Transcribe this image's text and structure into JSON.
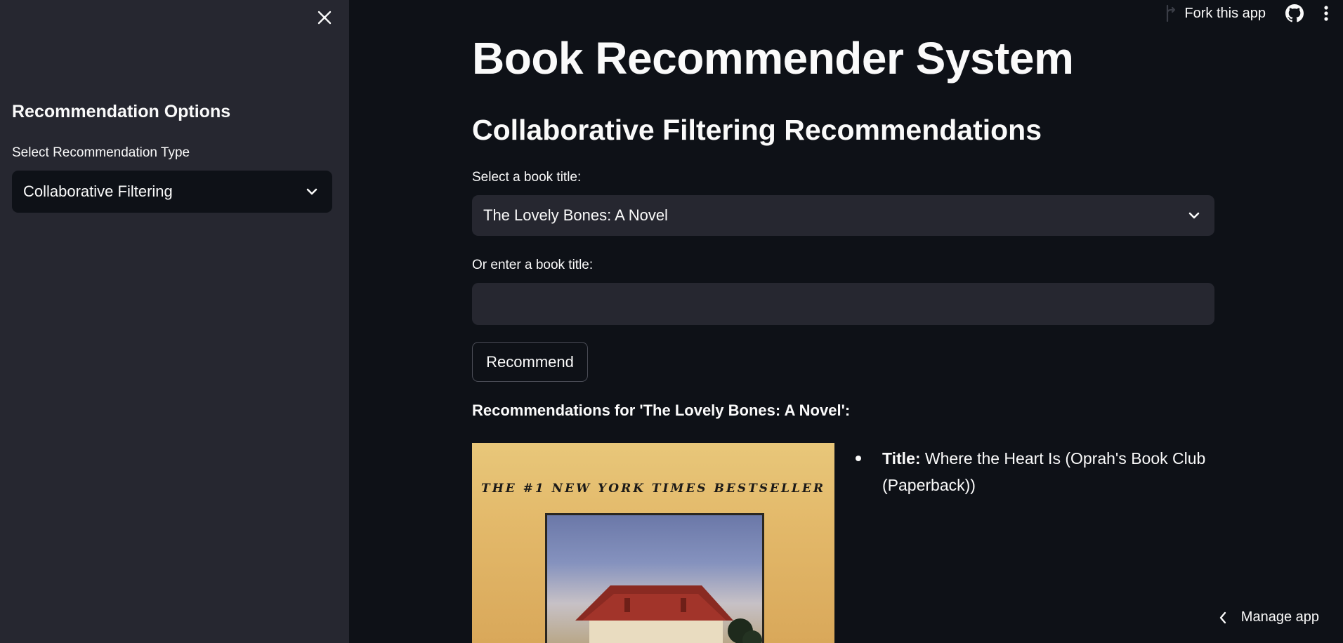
{
  "sidebar": {
    "heading": "Recommendation Options",
    "type_label": "Select Recommendation Type",
    "type_value": "Collaborative Filtering"
  },
  "header": {
    "fork_label": "Fork this app"
  },
  "main": {
    "title": "Book Recommender System",
    "subtitle": "Collaborative Filtering Recommendations",
    "select_label": "Select a book title:",
    "select_value": "The Lovely Bones: A Novel",
    "input_label": "Or enter a book title:",
    "input_value": "",
    "recommend_label": "Recommend",
    "results_heading": "Recommendations for 'The Lovely Bones: A Novel':"
  },
  "recommendations": [
    {
      "field_label": "Title:",
      "title": "Where the Heart Is (Oprah's Book Club (Paperback))",
      "cover_text": "THE #1 NEW YORK TIMES BESTSELLER"
    }
  ],
  "footer": {
    "manage_label": "Manage app"
  },
  "colors": {
    "background": "#0e1117",
    "sidebar": "#262730",
    "input": "#262730",
    "text": "#fafafa"
  }
}
